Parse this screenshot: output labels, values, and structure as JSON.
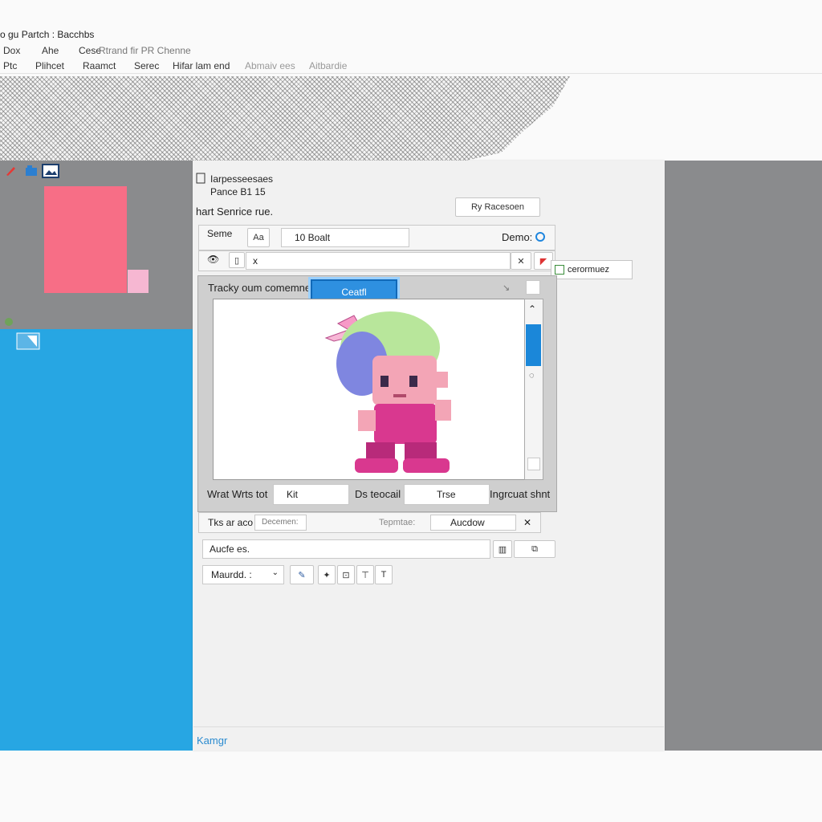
{
  "window": {
    "title": "o gu Partch : Bacchbs"
  },
  "menubar1": [
    "Dox",
    "Ahe",
    "Cese",
    "Rtrand  fir  PR  Chenne"
  ],
  "menubar2": [
    "Ptc",
    "Plihcet",
    "Raamct",
    "Serec",
    "Hifar lam end",
    "Abmaiv ees",
    "Aitbardie"
  ],
  "dialog": {
    "heading": "Iarpesseesaes",
    "subheading": "Pance B1 15",
    "section_label": "hart Senrice rue.",
    "top_right_button": "Ry Racesoen",
    "row1": {
      "label": "Seme",
      "value": "10  Boalt",
      "radio_label": "Demo:"
    },
    "row2": {
      "value": "x"
    },
    "tooltip": "cerormuez",
    "canvas_caption": "Tracky oum comemner",
    "create_button": "Ceatfl",
    "bottom_row": {
      "label1": "Wrat Wrts tot",
      "input1": "Kit",
      "label2": "Ds teocail",
      "input2": "Trse",
      "label3": "Ingrcuat shnt"
    },
    "row3": {
      "label": "Tks ar aco",
      "select1": "Decemen:",
      "label2": "Tepmtae:",
      "select2": "Aucdow"
    },
    "search": {
      "value": "Aucfe es."
    },
    "dropdown": {
      "value": "Maurdd. :"
    },
    "footer_label": "Kamgr"
  },
  "colors": {
    "accent": "#27a6e3",
    "swatch": "#f76e86",
    "swatch_small": "#f6b7d2"
  },
  "icons": [
    "red-feather-icon",
    "blue-tab-icon",
    "image-icon",
    "layer-icon",
    "checkbox-icon"
  ]
}
